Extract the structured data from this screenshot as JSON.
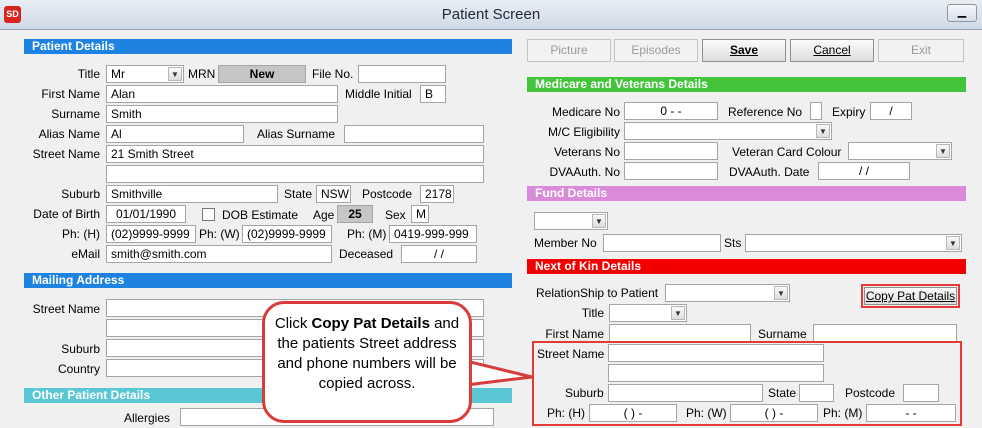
{
  "window": {
    "title": "Patient Screen",
    "app_icon": "SD",
    "minimize_glyph": "▁"
  },
  "patient_details": {
    "header": "Patient Details",
    "title_label": "Title",
    "title_value": "Mr",
    "mrn_label": "MRN",
    "mrn_value": "New",
    "file_no_label": "File No.",
    "file_no_value": "",
    "first_name_label": "First Name",
    "first_name_value": "Alan",
    "middle_initial_label": "Middle Initial",
    "middle_initial_value": "B",
    "surname_label": "Surname",
    "surname_value": "Smith",
    "alias_name_label": "Alias Name",
    "alias_name_value": "Al",
    "alias_surname_label": "Alias Surname",
    "alias_surname_value": "",
    "street_name_label": "Street Name",
    "street_line1": "21 Smith Street",
    "street_line2": "",
    "suburb_label": "Suburb",
    "suburb_value": "Smithville",
    "state_label": "State",
    "state_value": "NSW",
    "postcode_label": "Postcode",
    "postcode_value": "2178",
    "dob_label": "Date of Birth",
    "dob_value": "01/01/1990",
    "dob_estimate_label": "DOB Estimate",
    "age_label": "Age",
    "age_value": "25",
    "sex_label": "Sex",
    "sex_value": "M",
    "ph_h_label": "Ph: (H)",
    "ph_h_value": "(02)9999-9999",
    "ph_w_label": "Ph: (W)",
    "ph_w_value": "(02)9999-9999",
    "ph_m_label": "Ph: (M)",
    "ph_m_value": "0419-999-999",
    "email_label": "eMail",
    "email_value": "smith@smith.com",
    "deceased_label": "Deceased",
    "deceased_value": "/ /"
  },
  "mailing_address": {
    "header": "Mailing Address",
    "street_name_label": "Street Name",
    "suburb_label": "Suburb",
    "country_label": "Country"
  },
  "other_details": {
    "header": "Other Patient Details",
    "allergies_label": "Allergies"
  },
  "toolbar": {
    "picture": "Picture",
    "episodes": "Episodes",
    "save": "Save",
    "cancel": "Cancel",
    "exit": "Exit"
  },
  "medicare": {
    "header": "Medicare and Veterans Details",
    "medicare_no_label": "Medicare No",
    "medicare_no_value": "0  -  -",
    "reference_no_label": "Reference No",
    "expiry_label": "Expiry",
    "expiry_value": "/",
    "eligibility_label": "M/C Eligibility",
    "veterans_no_label": "Veterans No",
    "veteran_card_colour_label": "Veteran Card Colour",
    "dva_auth_no_label": "DVAAuth. No",
    "dva_auth_date_label": "DVAAuth. Date",
    "dva_auth_date_value": "/ /"
  },
  "fund": {
    "header": "Fund Details",
    "member_no_label": "Member No",
    "sts_label": "Sts"
  },
  "next_of_kin": {
    "header": "Next of Kin Details",
    "relationship_label": "RelationShip to Patient",
    "copy_button": "Copy Pat Details",
    "title_label": "Title",
    "first_name_label": "First Name",
    "surname_label": "Surname",
    "street_name_label": "Street Name",
    "suburb_label": "Suburb",
    "state_label": "State",
    "postcode_label": "Postcode",
    "ph_h_label": "Ph: (H)",
    "ph_h_value": "(  )   -",
    "ph_w_label": "Ph: (W)",
    "ph_w_value": "(  )   -",
    "ph_m_label": "Ph: (M)",
    "ph_m_value": "-   -"
  },
  "callout": {
    "pre": "Click ",
    "bold": "Copy Pat Details",
    "post": " and the patients Street address and phone numbers will be copied across."
  },
  "colors": {
    "patient_header": "#1e82e0",
    "medicare_header": "#44c43c",
    "fund_header": "#d98ad8",
    "nok_header": "#f20000",
    "other_header": "#59c7d4",
    "highlight": "#e53935"
  }
}
